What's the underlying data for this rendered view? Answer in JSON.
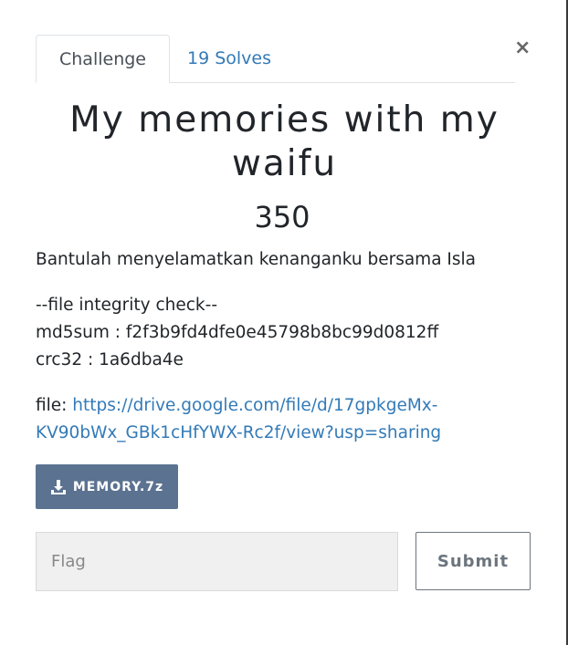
{
  "tabs": {
    "challenge_label": "Challenge",
    "solves_label": "19 Solves"
  },
  "close_label": "×",
  "challenge": {
    "title": "My memories with my waifu",
    "points": "350",
    "description": "Bantulah menyelamatkan kenanganku bersama Isla",
    "integrity_header": "--file integrity check--",
    "md5_line": "md5sum : f2f3b9fd4dfe0e45798b8bc99d0812ff",
    "crc_line": "crc32 : 1a6dba4e",
    "file_prefix": "file: ",
    "file_link": "https://drive.google.com/file/d/17gpkgeMx-KV90bWx_GBk1cHfYWX-Rc2f/view?usp=sharing"
  },
  "download": {
    "label": "MEMORY.7z",
    "icon": "download-icon"
  },
  "flag": {
    "placeholder": "Flag",
    "value": ""
  },
  "submit_label": "Submit",
  "colors": {
    "link": "#337ab7",
    "download_button": "#5b7290"
  }
}
